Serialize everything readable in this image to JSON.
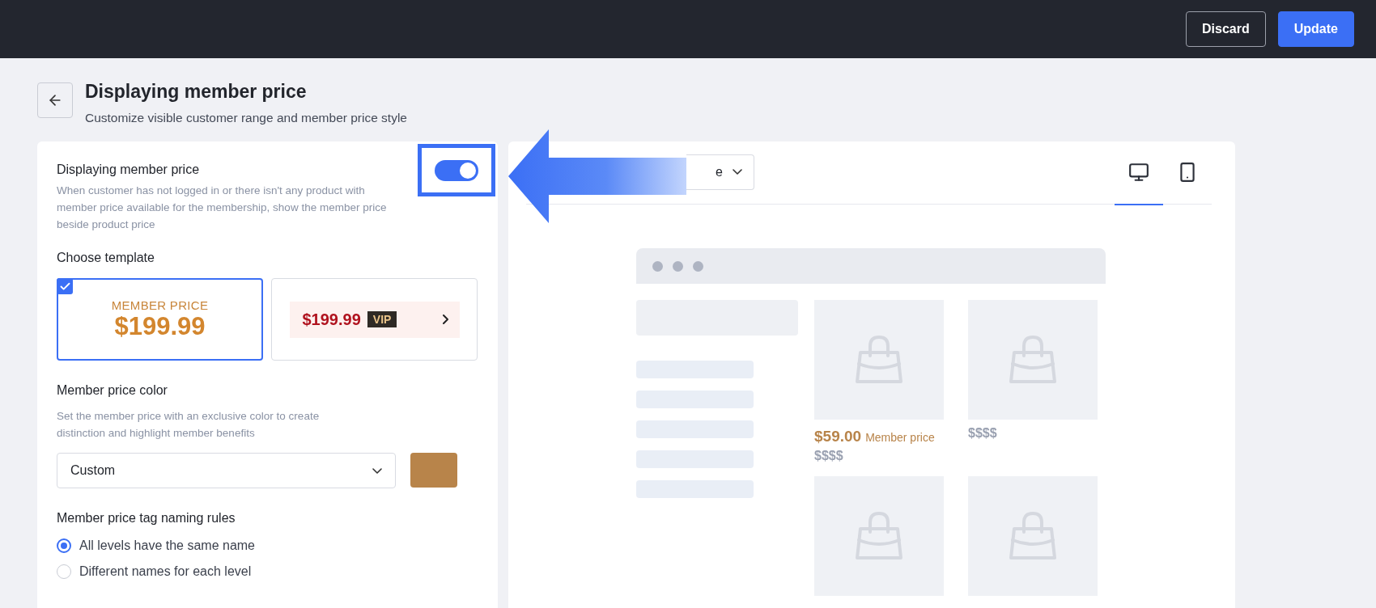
{
  "header": {
    "buttons": [
      {
        "label": "Discard",
        "kind": "secondary"
      },
      {
        "label": "Update",
        "kind": "primary"
      }
    ]
  },
  "page": {
    "title": "Displaying member price",
    "subtitle": "Customize visible customer range and member price style"
  },
  "settings": {
    "display": {
      "label": "Displaying member price",
      "description": "When customer has not logged in or there isn't any product with member price available for the membership, show the member price beside product price",
      "on": true,
      "highlighted": true
    },
    "template": {
      "heading": "Choose template",
      "options": [
        {
          "kind": "stacked",
          "caption": "MEMBER PRICE",
          "price": "$199.99",
          "selected": true
        },
        {
          "kind": "inline",
          "price": "$199.99",
          "badge": "VIP",
          "selected": false
        }
      ]
    },
    "color": {
      "heading": "Member price color",
      "description": "Set the member price with an exclusive color to create distinction and highlight member benefits",
      "select": {
        "value": "Custom"
      },
      "swatch": {
        "color": "#b8844a"
      }
    },
    "naming": {
      "heading": "Member price tag naming rules",
      "options": [
        {
          "label": "All levels have the same name",
          "selected": true
        },
        {
          "label": "Different names for each level",
          "selected": false
        }
      ]
    }
  },
  "preview": {
    "dropdown": {
      "value": "e"
    },
    "devices": [
      {
        "kind": "desktop",
        "selected": true
      },
      {
        "kind": "mobile",
        "selected": false
      }
    ],
    "products": [
      {
        "kind": "priced",
        "member_price": "$59.00",
        "member_label": "Member price",
        "price": "$$$$"
      },
      {
        "kind": "plain",
        "price": "$$$$"
      },
      {
        "kind": "image_only"
      },
      {
        "kind": "image_only"
      }
    ]
  }
}
